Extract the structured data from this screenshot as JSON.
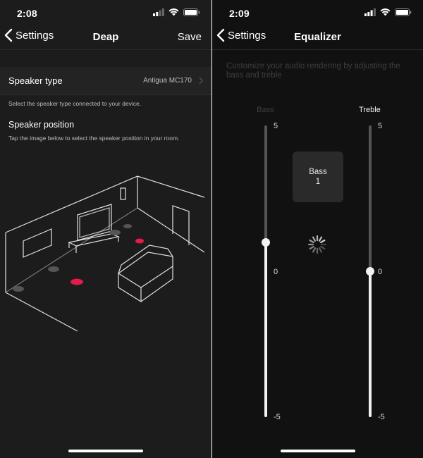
{
  "left": {
    "status": {
      "time": "2:08"
    },
    "nav": {
      "back_label": "Settings",
      "title": "Deap",
      "save_label": "Save"
    },
    "speaker_type": {
      "label": "Speaker type",
      "value": "Antigua MC170",
      "help": "Select the speaker type connected to your device."
    },
    "speaker_position": {
      "label": "Speaker position",
      "help": "Tap the image below to select the speaker position in your room."
    },
    "room": {
      "selected_color": "#e6194b",
      "unselected_color": "#555555"
    }
  },
  "right": {
    "status": {
      "time": "2:09"
    },
    "nav": {
      "back_label": "Settings",
      "title": "Equalizer"
    },
    "description": "Customize your audio rendering by adjusting the bass and treble",
    "bass": {
      "label": "Bass",
      "max_label": "5",
      "mid_label": "0",
      "min_label": "-5",
      "value": 1,
      "min": -5,
      "max": 5
    },
    "treble": {
      "label": "Treble",
      "max_label": "5",
      "mid_label": "0",
      "min_label": "-5",
      "value": 0,
      "min": -5,
      "max": 5
    },
    "value_card": {
      "title": "Bass",
      "value": "1"
    }
  }
}
